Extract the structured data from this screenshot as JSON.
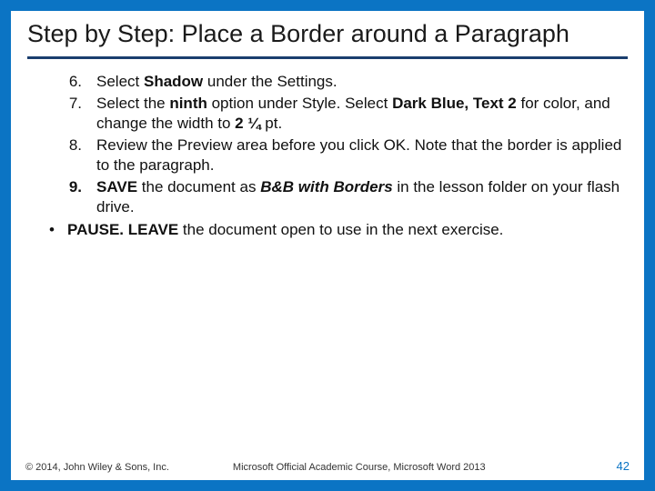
{
  "title": "Step by Step: Place a Border around a Paragraph",
  "steps": {
    "s6": {
      "num": "6.",
      "a": "Select ",
      "b": "Shadow ",
      "c": "under the Settings."
    },
    "s7": {
      "num": "7.",
      "a": "Select the ",
      "b": "ninth ",
      "c": "option under Style. Select ",
      "d": "Dark Blue, Text 2 ",
      "e": "for color, and change the width to ",
      "f": "2 ¼ ",
      "g": "pt."
    },
    "s8": {
      "num": "8.",
      "a": "Review the Preview area before you click OK. Note that the border is applied to the paragraph."
    },
    "s9": {
      "num": "9.",
      "a": "SAVE ",
      "b": "the document as ",
      "c": "B&B with Borders ",
      "d": "in the lesson folder on your flash drive."
    }
  },
  "bullet": {
    "mark": "•",
    "a": "PAUSE. LEAVE ",
    "b": "the document open to use in the next exercise."
  },
  "footer": {
    "copyright": "© 2014, John Wiley & Sons, Inc.",
    "course": "Microsoft Official Academic Course, Microsoft Word 2013",
    "page": "42"
  }
}
